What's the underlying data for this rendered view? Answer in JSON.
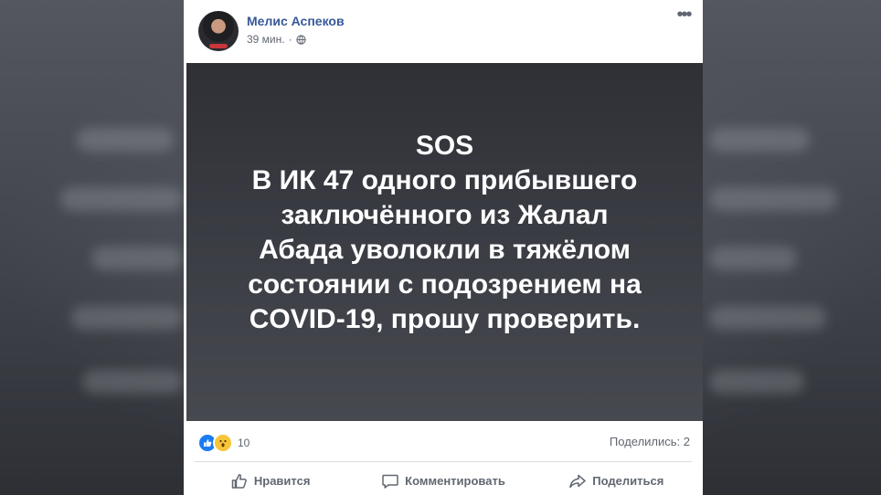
{
  "post": {
    "author": "Мелис Аспеков",
    "time": "39 мин.",
    "separator": "·",
    "image_text": "SOS\nВ ИК 47 одного прибывшего\nзаключённого из Жалал\nАбада уволокли в тяжёлом\nсостоянии с подозрением на\nCOVID-19, прошу проверить."
  },
  "stats": {
    "reactions": [
      "like-icon",
      "wow-icon"
    ],
    "reaction_count": "10",
    "shares": "Поделились: 2"
  },
  "actions": {
    "like": "Нравится",
    "comment": "Комментировать",
    "share": "Поделиться"
  },
  "colors": {
    "author": "#385898",
    "meta": "#606770",
    "like_reaction": "#1b7cf2",
    "wow_reaction": "#f7c53a",
    "image_bg": "#3b3d44"
  }
}
